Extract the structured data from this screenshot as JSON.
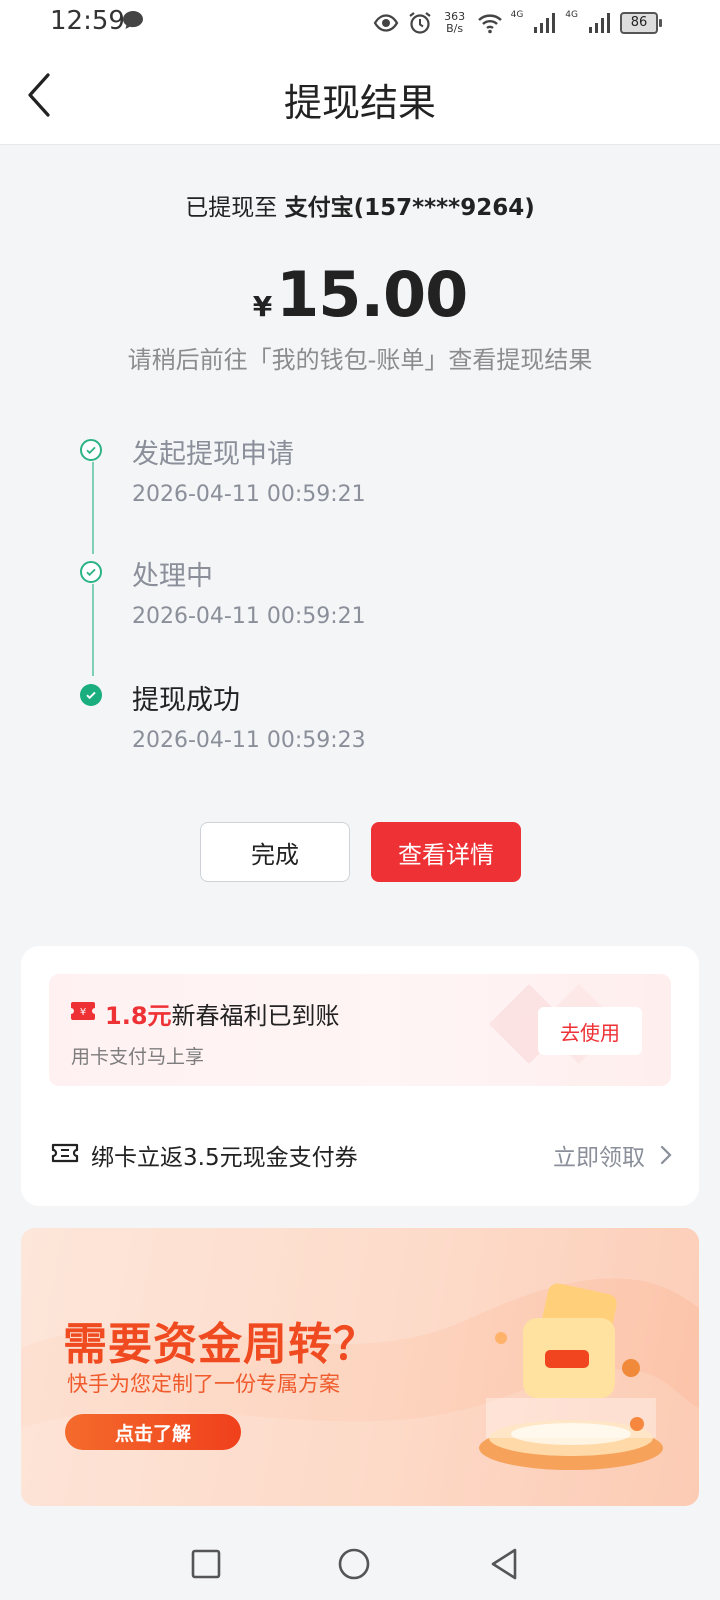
{
  "status_bar": {
    "time": "12:59",
    "speed_top": "363",
    "speed_bottom": "B/s",
    "net1": "4G",
    "net2": "4G",
    "battery": "86"
  },
  "header": {
    "title": "提现结果"
  },
  "result": {
    "dest_prefix": "已提现至",
    "dest_account": "支付宝(157****9264)",
    "currency": "¥",
    "amount": "15.00",
    "tip": "请稍后前往「我的钱包-账单」查看提现结果"
  },
  "timeline": [
    {
      "title": "发起提现申请",
      "time": "2026-04-11 00:59:21"
    },
    {
      "title": "处理中",
      "time": "2026-04-11 00:59:21"
    },
    {
      "title": "提现成功",
      "time": "2026-04-11 00:59:23"
    }
  ],
  "actions": {
    "done": "完成",
    "detail": "查看详情"
  },
  "promo": {
    "amount": "1.8元",
    "title": "新春福利已到账",
    "subtitle": "用卡支付马上享",
    "button": "去使用"
  },
  "coupon": {
    "text": "绑卡立返3.5元现金支付券",
    "link": "立即领取"
  },
  "banner": {
    "title": "需要资金周转？",
    "subtitle": "快手为您定制了一份专属方案",
    "button": "点击了解"
  },
  "colors": {
    "accent_red": "#ee3135",
    "success_green": "#1aad7d",
    "banner_orange": "#f04a20"
  }
}
